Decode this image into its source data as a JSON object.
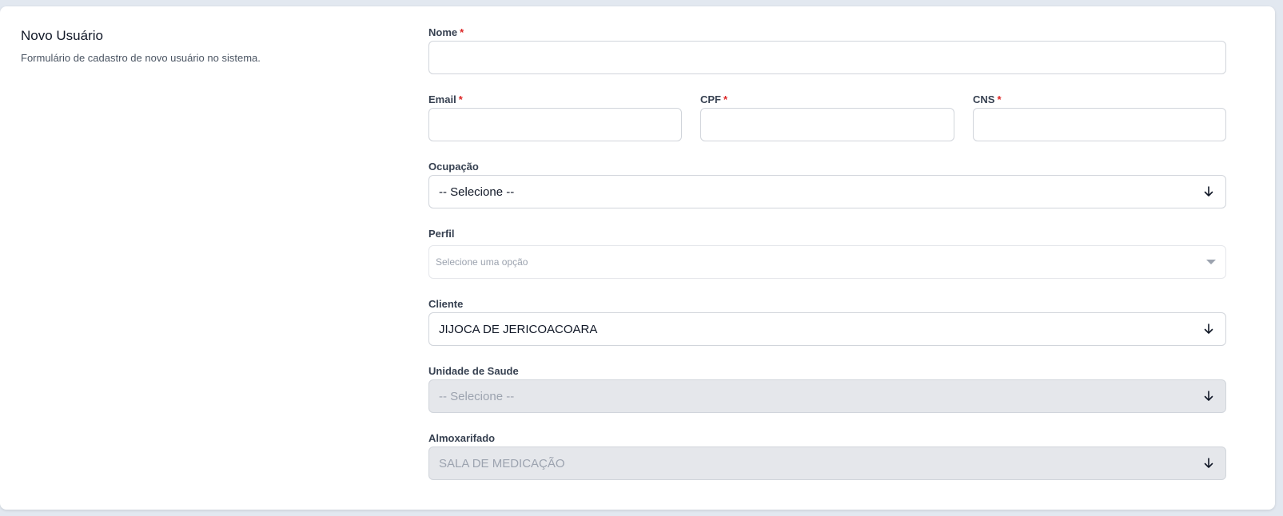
{
  "intro": {
    "title": "Novo Usuário",
    "description": "Formulário de cadastro de novo usuário no sistema."
  },
  "fields": {
    "nome": {
      "label": "Nome",
      "required_mark": "*",
      "value": ""
    },
    "email": {
      "label": "Email",
      "required_mark": "*",
      "value": ""
    },
    "cpf": {
      "label": "CPF",
      "required_mark": "*",
      "value": ""
    },
    "cns": {
      "label": "CNS",
      "required_mark": "*",
      "value": ""
    },
    "ocupacao": {
      "label": "Ocupação",
      "selected": "-- Selecione --",
      "icon": "arrow-down-icon"
    },
    "perfil": {
      "label": "Perfil",
      "placeholder": "Selecione uma opção",
      "icon": "caret-down-icon"
    },
    "cliente": {
      "label": "Cliente",
      "selected": "JIJOCA DE JERICOACOARA",
      "icon": "arrow-down-icon"
    },
    "unidade_saude": {
      "label": "Unidade de Saude",
      "selected": "-- Selecione --",
      "disabled": true,
      "icon": "arrow-down-icon"
    },
    "almoxarifado": {
      "label": "Almoxarifado",
      "selected": "SALA DE MEDICAÇÃO",
      "disabled": true,
      "icon": "arrow-down-icon"
    }
  },
  "colors": {
    "required": "#dc2626",
    "border": "#d1d5db",
    "disabled_bg": "#e5e7eb",
    "page_bg": "#e2e8f0"
  }
}
